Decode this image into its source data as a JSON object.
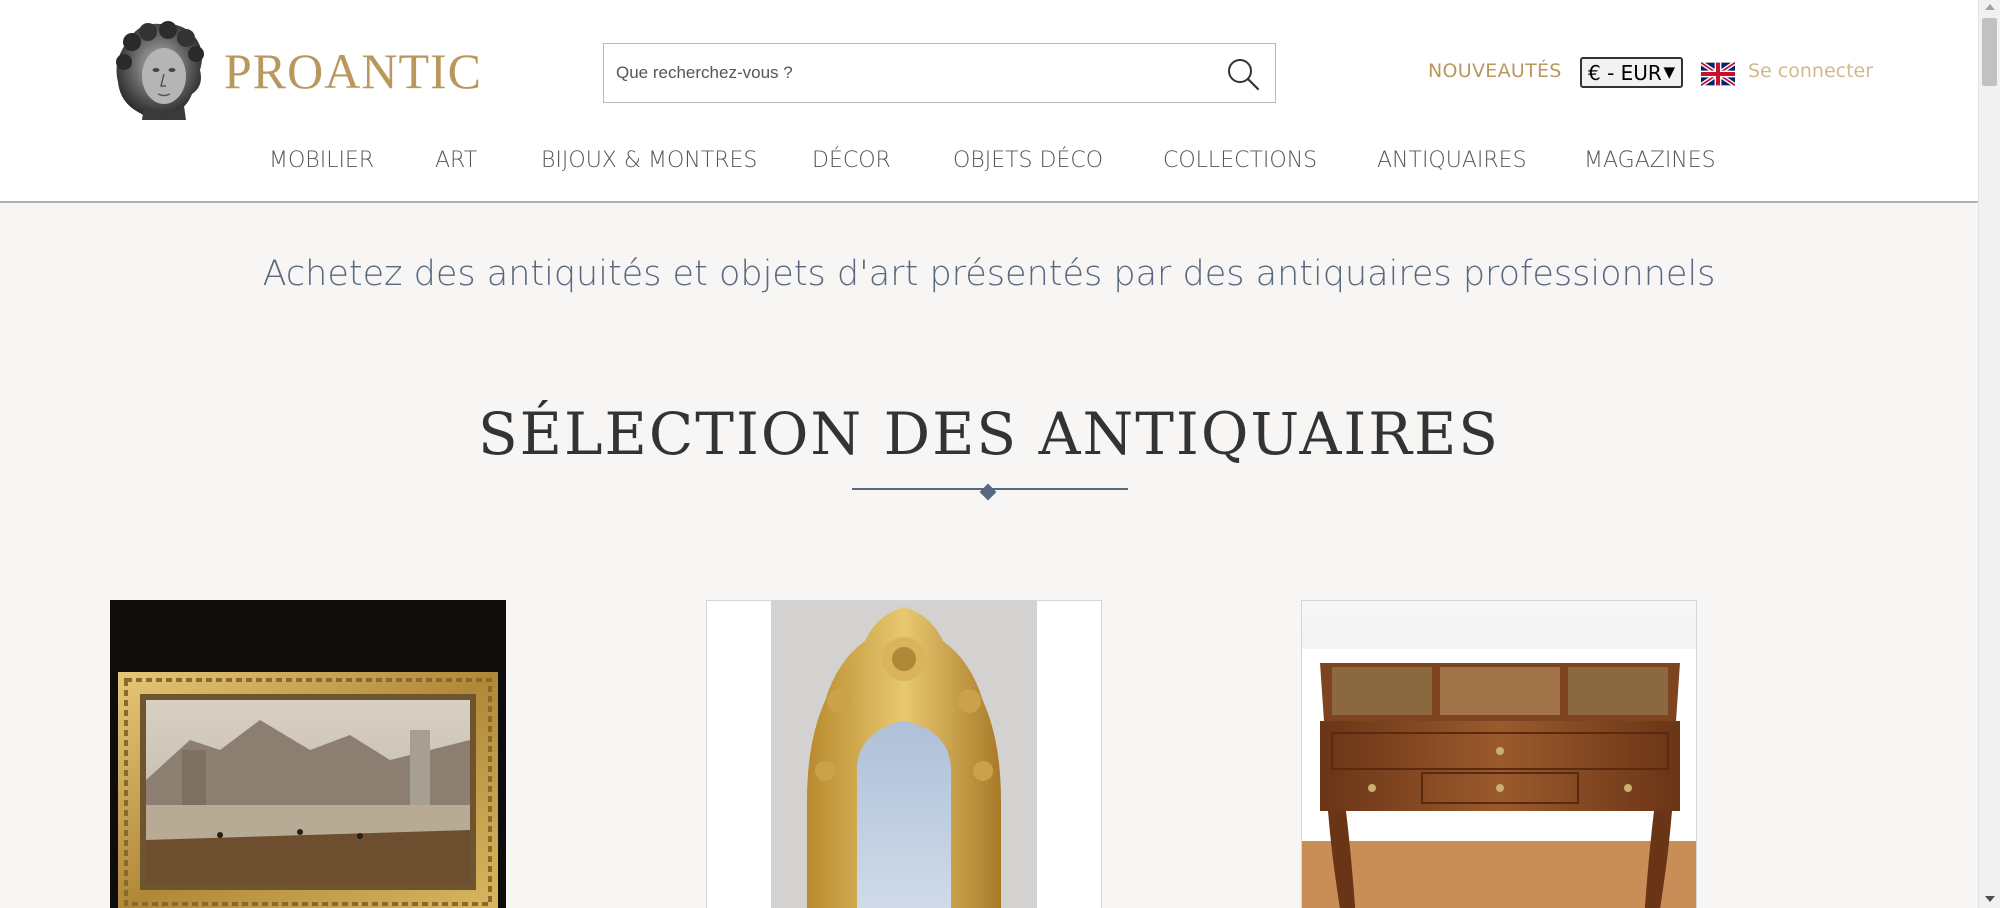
{
  "logo": {
    "text": "PROANTIC",
    "icon": "sculpted-head-bust"
  },
  "search": {
    "placeholder": "Que recherchez-vous ?",
    "icon": "magnifier-icon"
  },
  "header_links": {
    "nouveautes": "NOUVEAUTÉS",
    "currency": "€ - EUR",
    "login": "Se connecter",
    "language_flag": "uk-flag"
  },
  "nav": {
    "items": [
      "MOBILIER",
      "ART",
      "BIJOUX & MONTRES",
      "DÉCOR",
      "OBJETS DÉCO",
      "COLLECTIONS",
      "ANTIQUAIRES",
      "MAGAZINES"
    ]
  },
  "main": {
    "tagline": "Achetez des antiquités et objets d'art présentés par des antiquaires professionnels",
    "section_title": "SÉLECTION DES ANTIQUAIRES",
    "products": [
      {
        "image": "gilt-framed-river-landscape-painting"
      },
      {
        "image": "carved-giltwood-mirror"
      },
      {
        "image": "walnut-dressing-table"
      }
    ]
  },
  "colors": {
    "brand_gold": "#b9985e",
    "nav_text": "#555555",
    "accent_slate": "#58697f",
    "page_bg": "#f7f6f4"
  }
}
